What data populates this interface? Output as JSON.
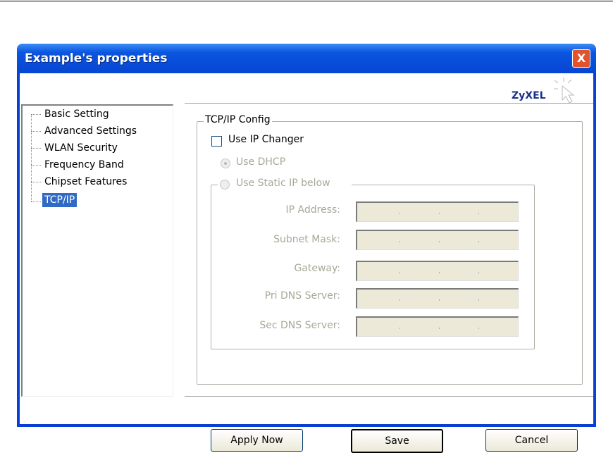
{
  "window": {
    "title": "Example's properties",
    "close_label": "X",
    "logo": "ZyXEL"
  },
  "tree": {
    "items": [
      {
        "label": "Basic Setting"
      },
      {
        "label": "Advanced Settings"
      },
      {
        "label": "WLAN Security"
      },
      {
        "label": "Frequency Band"
      },
      {
        "label": "Chipset Features"
      },
      {
        "label": "TCP/IP",
        "selected": true
      }
    ]
  },
  "config": {
    "group_title": "TCP/IP Config",
    "use_ip_changer": "Use IP Changer",
    "use_ip_changer_checked": false,
    "use_dhcp": "Use DHCP",
    "use_static": "Use Static IP below",
    "fields": [
      {
        "label": "IP Address:"
      },
      {
        "label": "Subnet Mask:"
      },
      {
        "label": "Gateway:"
      },
      {
        "label": "Pri DNS Server:"
      },
      {
        "label": "Sec DNS Server:"
      }
    ]
  },
  "buttons": {
    "apply": "Apply Now",
    "save": "Save",
    "cancel": "Cancel"
  }
}
